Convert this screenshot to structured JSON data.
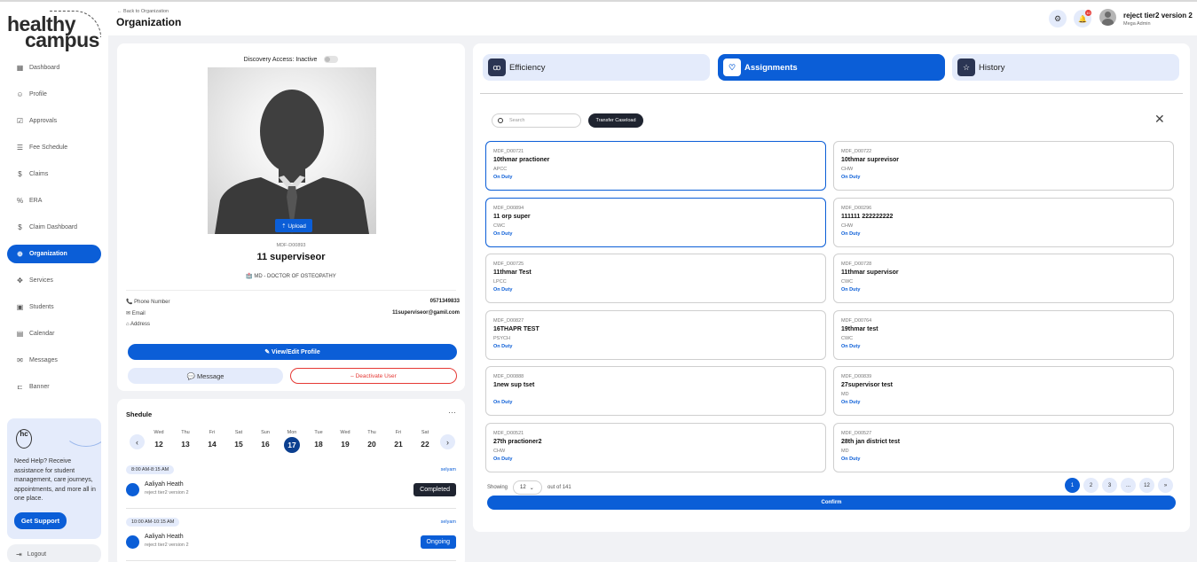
{
  "brand": {
    "line1": "healthy",
    "line2": "campus"
  },
  "sidebar": {
    "items": [
      {
        "label": "Dashboard",
        "icon": "grid-icon",
        "glyph": "▦"
      },
      {
        "label": "Profile",
        "icon": "profile-icon",
        "glyph": "☺"
      },
      {
        "label": "Approvals",
        "icon": "approvals-icon",
        "glyph": "☑"
      },
      {
        "label": "Fee Schedule",
        "icon": "fee-schedule-icon",
        "glyph": "☰"
      },
      {
        "label": "Claims",
        "icon": "claims-icon",
        "glyph": "$"
      },
      {
        "label": "ERA",
        "icon": "era-icon",
        "glyph": "%"
      },
      {
        "label": "Claim Dashboard",
        "icon": "claim-dashboard-icon",
        "glyph": "$"
      },
      {
        "label": "Organization",
        "icon": "globe-icon",
        "glyph": "⊕"
      },
      {
        "label": "Services",
        "icon": "services-icon",
        "glyph": "✥"
      },
      {
        "label": "Students",
        "icon": "students-icon",
        "glyph": "▣"
      },
      {
        "label": "Calendar",
        "icon": "calendar-icon",
        "glyph": "▤"
      },
      {
        "label": "Messages",
        "icon": "messages-icon",
        "glyph": "✉"
      },
      {
        "label": "Banner",
        "icon": "banner-icon",
        "glyph": "⊏"
      }
    ],
    "help": {
      "logo_text": "hc",
      "text": "Need Help? Receive assistance for student management, care journeys, appointments, and more all in one place.",
      "button": "Get Support"
    },
    "logout": "Logout",
    "logout_glyph": "⇥"
  },
  "header": {
    "back": "← Back to Organization",
    "title": "Organization",
    "settings_glyph": "⚙",
    "bell_glyph": "🔔",
    "notif_count": "10",
    "user_name": "reject tier2 version 2",
    "user_role": "Mega Admin"
  },
  "profile": {
    "discovery": "Discovery Access: Inactive",
    "upload": "⇡ Upload",
    "mdf_id": "MDF-D00893",
    "name": "11 superviseor",
    "degree": "🏥 MD - DOCTOR OF OSTEOPATHY",
    "phone_label": "📞 Phone Number",
    "phone_value": "0571349833",
    "email_label": "✉ Email",
    "email_value": "11superviseor@gamil.com",
    "address_label": "⌂ Address",
    "view_edit": "✎ View/Edit Profile",
    "message": "💬 Message",
    "deactivate": "– Deactivate User"
  },
  "schedule": {
    "title": "Shedule",
    "menu": "···",
    "prev": "‹",
    "next": "›",
    "days": [
      {
        "name": "Wed",
        "date": "12"
      },
      {
        "name": "Thu",
        "date": "13"
      },
      {
        "name": "Fri",
        "date": "14"
      },
      {
        "name": "Sat",
        "date": "15"
      },
      {
        "name": "Sun",
        "date": "16"
      },
      {
        "name": "Mon",
        "date": "17"
      },
      {
        "name": "Tue",
        "date": "18"
      },
      {
        "name": "Wed",
        "date": "19"
      },
      {
        "name": "Thu",
        "date": "20"
      },
      {
        "name": "Fri",
        "date": "21"
      },
      {
        "name": "Sat",
        "date": "22"
      }
    ],
    "selected_day": 5,
    "appointments": [
      {
        "time": "8:00 AM-8:15 AM",
        "link": "selyam",
        "name": "Aaliyah Heath",
        "sub": "reject tier2 version 2",
        "status": "Completed",
        "status_color": "#1f2430"
      },
      {
        "time": "10:00 AM-10:15 AM",
        "link": "selyam",
        "name": "Aaliyah Heath",
        "sub": "reject tier2 version 2",
        "status": "Ongoing",
        "status_color": "#0b5ed7"
      }
    ]
  },
  "assign": {
    "tabs": [
      {
        "label": "Efficiency",
        "icon": "users-icon",
        "glyph": "ꝏ",
        "active": false
      },
      {
        "label": "Assignments",
        "icon": "heart-icon",
        "glyph": "♡",
        "active": true
      },
      {
        "label": "History",
        "icon": "star-icon",
        "glyph": "☆",
        "active": false
      }
    ],
    "search_placeholder": "Search",
    "transfer": "Transfer Caseload",
    "close": "✕",
    "cards": [
      {
        "id": "MDF_D00721",
        "name": "10thmar practioner",
        "type": "APCC",
        "status": "On Duty",
        "selected": true
      },
      {
        "id": "MDF_D00722",
        "name": "10thmar suprevisor",
        "type": "CHW",
        "status": "On Duty",
        "selected": false
      },
      {
        "id": "MDF_D00894",
        "name": "11 orp super",
        "type": "CWC",
        "status": "On Duty",
        "selected": true
      },
      {
        "id": "MDF_D00296",
        "name": "111111 222222222",
        "type": "CHW",
        "status": "On Duty",
        "selected": false
      },
      {
        "id": "MDF_D00725",
        "name": "11thmar Test",
        "type": "LPCC",
        "status": "On Duty",
        "selected": false
      },
      {
        "id": "MDF_D00728",
        "name": "11thmar supervisor",
        "type": "CWC",
        "status": "On Duty",
        "selected": false
      },
      {
        "id": "MDF_D00827",
        "name": "16THAPR TEST",
        "type": "PSYCH",
        "status": "On Duty",
        "selected": false
      },
      {
        "id": "MDF_D00764",
        "name": "19thmar test",
        "type": "CWC",
        "status": "On Duty",
        "selected": false
      },
      {
        "id": "MDF_D00888",
        "name": "1new sup tset",
        "type": "",
        "status": "On Duty",
        "selected": false
      },
      {
        "id": "MDF_D00839",
        "name": "27supervisor test",
        "type": "MD",
        "status": "On Duty",
        "selected": false
      },
      {
        "id": "MDF_D00521",
        "name": "27th practioner2",
        "type": "CHW",
        "status": "On Duty",
        "selected": false
      },
      {
        "id": "MDF_D00527",
        "name": "28th jan district test",
        "type": "MD",
        "status": "On Duty",
        "selected": false
      }
    ],
    "showing": "Showing",
    "per_page": "12",
    "out_of": "out of 141",
    "pages": [
      "1",
      "2",
      "3",
      "...",
      "12",
      "»"
    ],
    "active_page": 0,
    "confirm": "Confirm",
    "accent": "#0b5ed7"
  }
}
